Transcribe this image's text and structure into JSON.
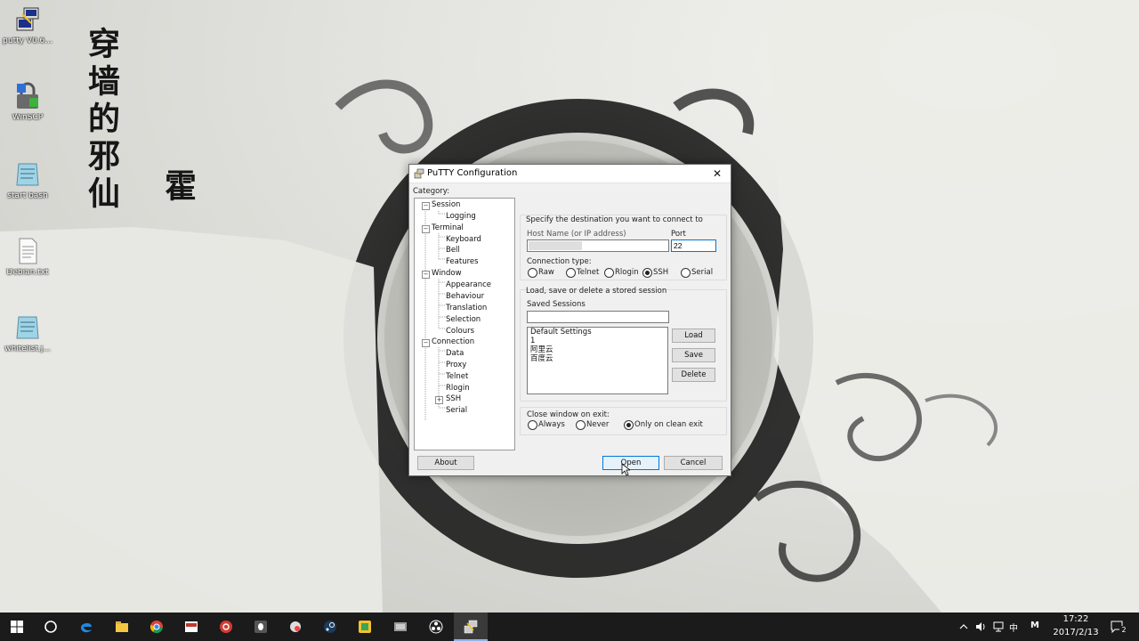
{
  "desktop": {
    "calligraphy_main": "穿墙的邪仙",
    "calligraphy_side": "霍",
    "icons": [
      {
        "label": "putty V0.6...",
        "icon": "putty-icon"
      },
      {
        "label": "WinSCP",
        "icon": "winscp-icon"
      },
      {
        "label": "start bash",
        "icon": "bash-icon"
      },
      {
        "label": "Debian.txt",
        "icon": "text-file-icon"
      },
      {
        "label": "whitelist.j...",
        "icon": "notepad-icon"
      }
    ]
  },
  "putty": {
    "title": "PuTTY Configuration",
    "close_glyph": "✕",
    "category_label": "Category:",
    "tree": [
      {
        "label": "Session",
        "level": 0,
        "expander": "−"
      },
      {
        "label": "Logging",
        "level": 1
      },
      {
        "label": "Terminal",
        "level": 0,
        "expander": "−"
      },
      {
        "label": "Keyboard",
        "level": 1
      },
      {
        "label": "Bell",
        "level": 1
      },
      {
        "label": "Features",
        "level": 1
      },
      {
        "label": "Window",
        "level": 0,
        "expander": "−"
      },
      {
        "label": "Appearance",
        "level": 1
      },
      {
        "label": "Behaviour",
        "level": 1
      },
      {
        "label": "Translation",
        "level": 1
      },
      {
        "label": "Selection",
        "level": 1
      },
      {
        "label": "Colours",
        "level": 1
      },
      {
        "label": "Connection",
        "level": 0,
        "expander": "−"
      },
      {
        "label": "Data",
        "level": 1
      },
      {
        "label": "Proxy",
        "level": 1
      },
      {
        "label": "Telnet",
        "level": 1
      },
      {
        "label": "Rlogin",
        "level": 1
      },
      {
        "label": "SSH",
        "level": 1,
        "expander": "+"
      },
      {
        "label": "Serial",
        "level": 1
      }
    ],
    "destination_heading": "Specify the destination you want to connect to",
    "host_label": "Host Name (or IP address)",
    "host_value": "",
    "port_label": "Port",
    "port_value": "22",
    "connection_type_label": "Connection type:",
    "connection_types": [
      "Raw",
      "Telnet",
      "Rlogin",
      "SSH",
      "Serial"
    ],
    "connection_type_selected": "SSH",
    "sessions_heading": "Load, save or delete a stored session",
    "saved_sessions_label": "Saved Sessions",
    "saved_sessions_value": "",
    "sessions": [
      "Default Settings",
      "1",
      "阿里云",
      "百度云"
    ],
    "load_label": "Load",
    "save_label": "Save",
    "delete_label": "Delete",
    "close_window_label": "Close window on exit:",
    "close_options": [
      "Always",
      "Never",
      "Only on clean exit"
    ],
    "close_option_selected": "Only on clean exit",
    "about_label": "About",
    "open_label": "Open",
    "cancel_label": "Cancel"
  },
  "taskbar": {
    "pinned": [
      "windows-start-icon",
      "cortana-icon",
      "edge-icon",
      "file-explorer-icon",
      "chrome-icon",
      "app-icon",
      "netease-music-icon",
      "qq-icon",
      "browser-icon",
      "steam-icon",
      "app-green-icon",
      "virtual-machine-icon",
      "obs-icon",
      "putty-icon"
    ],
    "active": "putty-icon",
    "tray": {
      "ime_label": "中",
      "m_label": "M",
      "time": "17:22",
      "date": "2017/2/13",
      "notification_count": "2"
    }
  }
}
